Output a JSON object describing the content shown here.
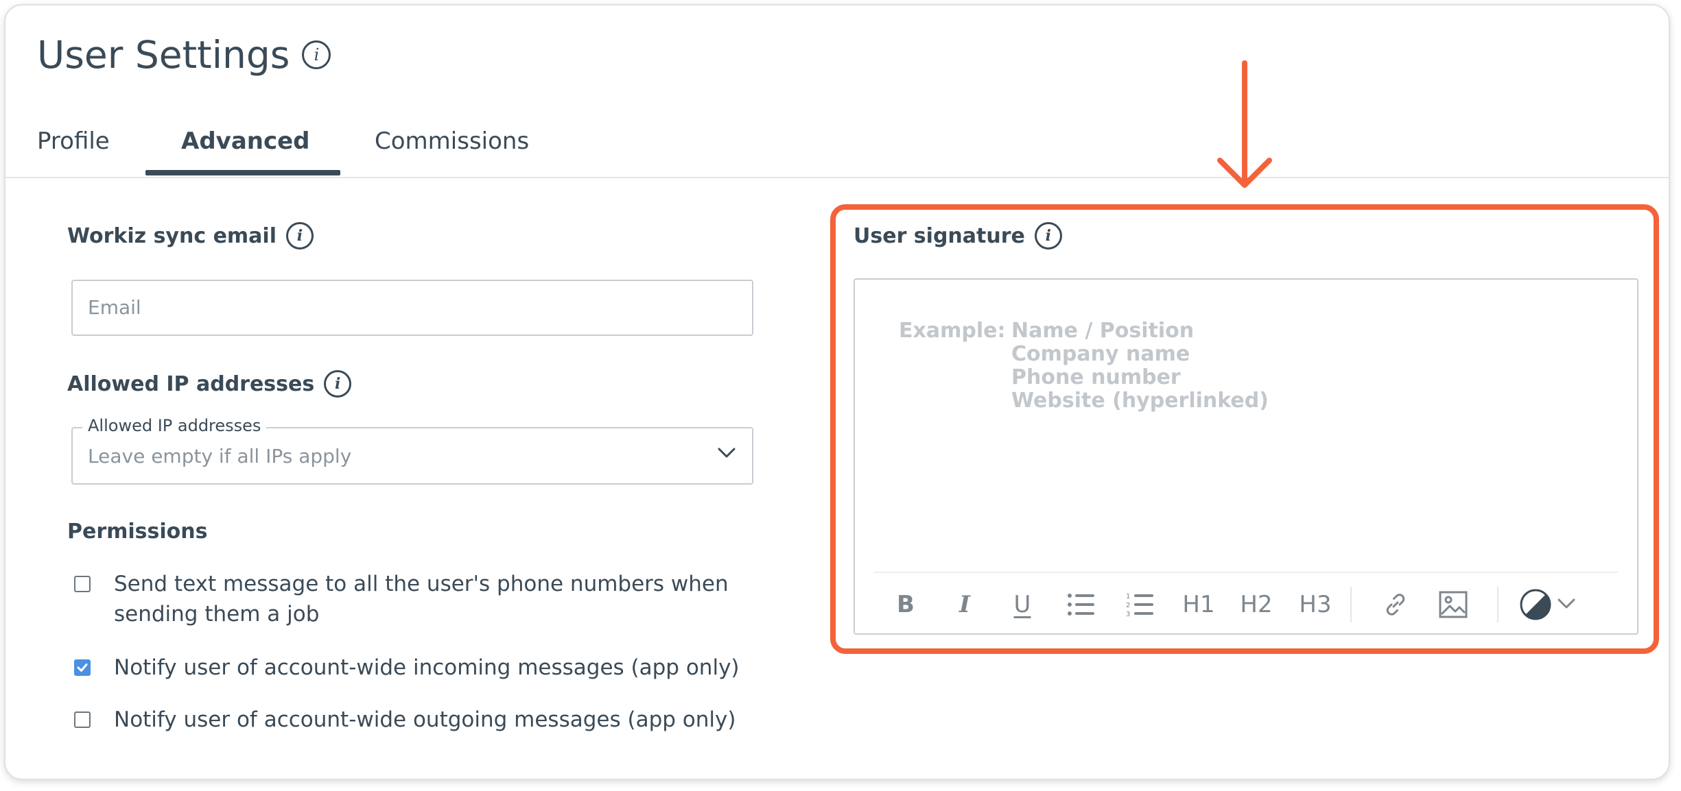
{
  "page": {
    "title": "User Settings",
    "title_info_icon": "info-icon"
  },
  "tabs": [
    {
      "label": "Profile",
      "active": false
    },
    {
      "label": "Advanced",
      "active": true
    },
    {
      "label": "Commissions",
      "active": false
    }
  ],
  "sync_email": {
    "label": "Workiz sync email",
    "placeholder": "Email",
    "value": ""
  },
  "allowed_ips": {
    "label": "Allowed IP addresses",
    "field_legend": "Allowed IP addresses",
    "placeholder": "Leave empty if all IPs apply"
  },
  "permissions": {
    "label": "Permissions",
    "items": [
      {
        "line1": "Send text message to all the user's phone numbers when",
        "line2": "sending them a job",
        "checked": false
      },
      {
        "line1": "Notify user of account-wide incoming messages (app only)",
        "line2": "",
        "checked": true
      },
      {
        "line1": "Notify user of account-wide outgoing messages (app only)",
        "line2": "",
        "checked": false
      }
    ]
  },
  "signature": {
    "label": "User signature",
    "example_label": "Example:",
    "example_lines": [
      "Name / Position",
      "Company name",
      "Phone number",
      "Website (hyperlinked)"
    ],
    "toolbar": {
      "bold": "B",
      "italic": "I",
      "underline": "U",
      "h1": "H1",
      "h2": "H2",
      "h3": "H3"
    }
  },
  "colors": {
    "accent": "#f4623a",
    "checkbox": "#4a90e2",
    "text": "#3a4a57"
  }
}
